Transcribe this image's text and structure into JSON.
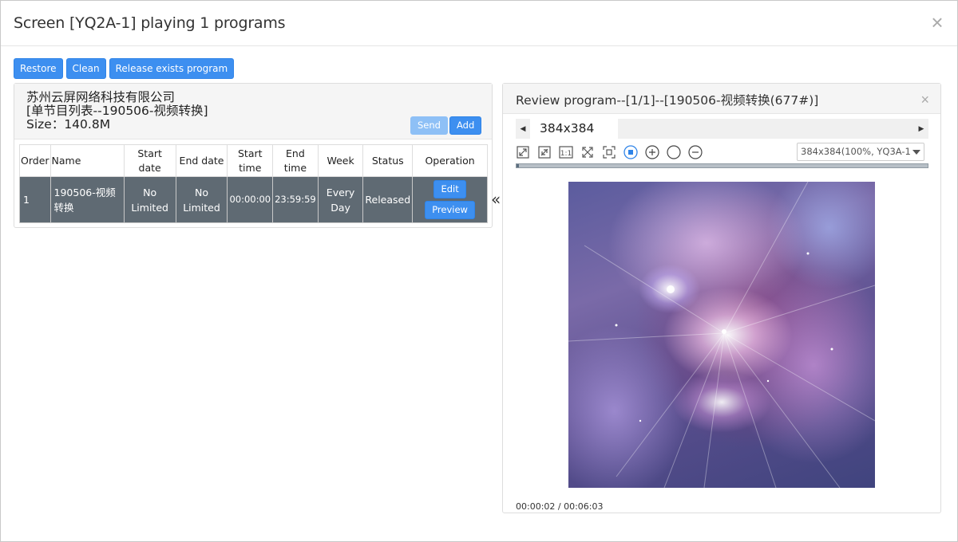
{
  "modal": {
    "title": "Screen [YQ2A-1] playing 1 programs",
    "close_glyph": "×"
  },
  "toolbar": {
    "restore_label": "Restore",
    "clean_label": "Clean",
    "release_label": "Release exists program"
  },
  "program_list": {
    "company": "苏州云屏网络科技有限公司",
    "list_name": "[单节目列表--190506-视频转换]",
    "size": "Size：140.8M",
    "send_label": "Send",
    "add_label": "Add",
    "columns": [
      "Order",
      "Name",
      "Start date",
      "End date",
      "Start time",
      "End time",
      "Week",
      "Status",
      "Operation"
    ],
    "rows": [
      {
        "order": "1",
        "name": "190506-视频转换",
        "start_date": "No Limited",
        "end_date": "No Limited",
        "start_time": "00:00:00",
        "end_time": "23:59:59",
        "week": "Every Day",
        "status": "Released",
        "edit_label": "Edit",
        "preview_label": "Preview"
      }
    ]
  },
  "collapse_glyph": "«",
  "review": {
    "title": "Review program--[1/1]--[190506-视频转换(677#)]",
    "close_glyph": "×",
    "tab_label": "384x384",
    "zoom_value": "384x384(100%, YQ3A-1",
    "progress_fraction": 0.006,
    "timecode": "00:00:02 / 00:06:03"
  },
  "colors": {
    "primary_button": "#3d8ff0",
    "row_background": "#5f6a73"
  }
}
